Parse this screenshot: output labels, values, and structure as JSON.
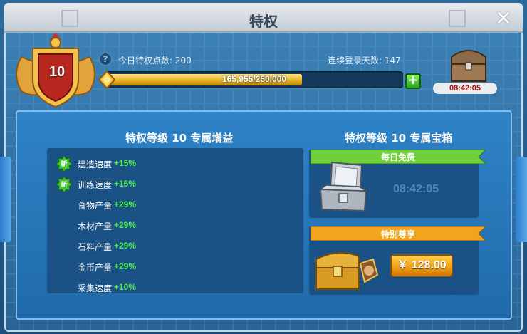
{
  "title": "特权",
  "badge": {
    "level": "10"
  },
  "stats": {
    "privilege_points": "今日特权点数: 200",
    "login_days": "连续登录天数: 147"
  },
  "progress": {
    "text": "165,955/250,000",
    "fraction": 0.6638
  },
  "top_chest": {
    "timer": "08:42:05"
  },
  "sections": {
    "benefits_title": "特权等级 10 专属增益",
    "rewards_title": "特权等级 10 专属宝箱"
  },
  "new_tag": "新",
  "benefits": [
    {
      "label": "建造速度",
      "value": "+15%",
      "is_new": true
    },
    {
      "label": "训练速度",
      "value": "+15%",
      "is_new": true
    },
    {
      "label": "食物产量",
      "value": "+29%",
      "is_new": false
    },
    {
      "label": "木材产量",
      "value": "+29%",
      "is_new": false
    },
    {
      "label": "石料产量",
      "value": "+29%",
      "is_new": false
    },
    {
      "label": "金币产量",
      "value": "+29%",
      "is_new": false
    },
    {
      "label": "采集速度",
      "value": "+10%",
      "is_new": false
    }
  ],
  "rewards": {
    "free": {
      "ribbon": "每日免费",
      "timer": "08:42:05",
      "color": "#6fcf3a"
    },
    "exclusive": {
      "ribbon": "特别尊享",
      "price": "￥ 128.00",
      "color": "#f0a51c"
    }
  },
  "colors": {
    "accent_green": "#4ef04a",
    "timer_red": "#b5151a",
    "panel_blue": "#2f83c6"
  }
}
